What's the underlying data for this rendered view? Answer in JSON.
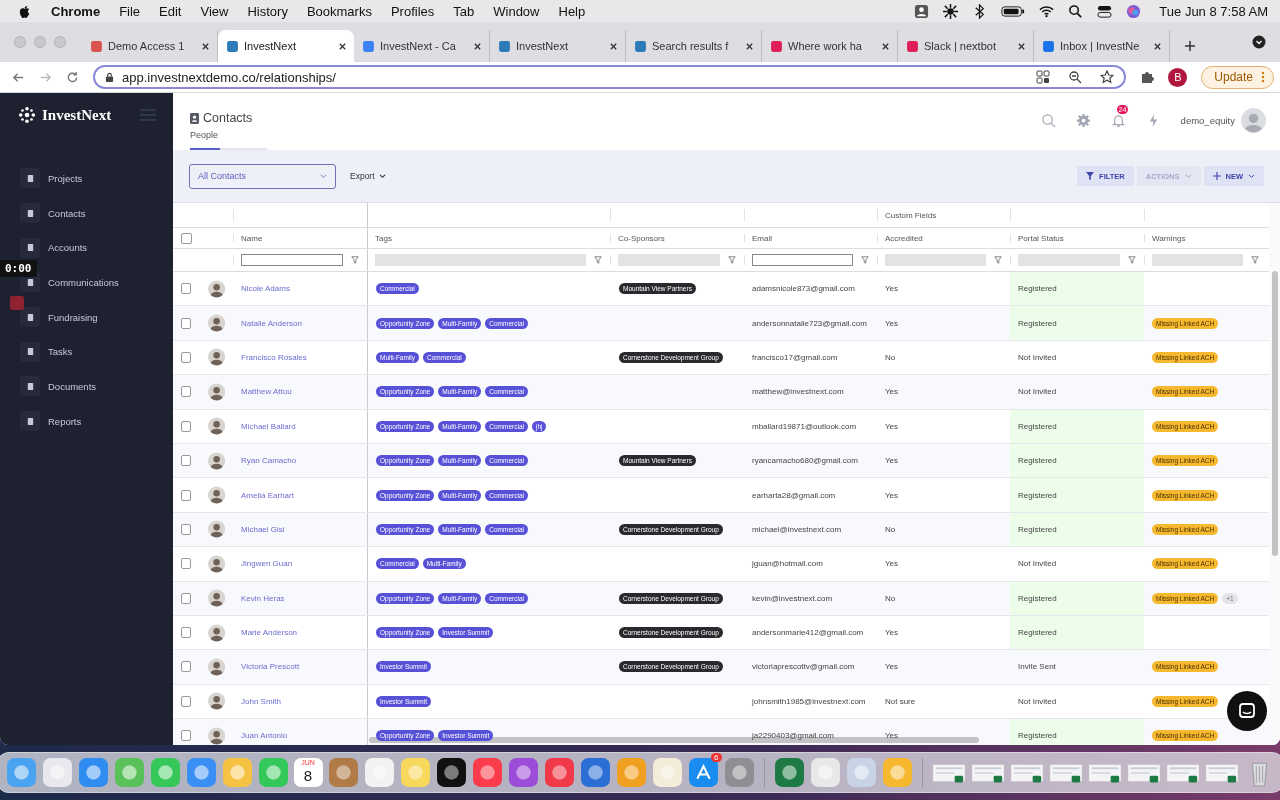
{
  "menubar": {
    "app": "Chrome",
    "menus": [
      "File",
      "Edit",
      "View",
      "History",
      "Bookmarks",
      "Profiles",
      "Tab",
      "Window",
      "Help"
    ],
    "clock": "Tue Jun 8  7:58 AM"
  },
  "browser": {
    "tabs": [
      {
        "title": "Demo Access 1",
        "selected": false
      },
      {
        "title": "InvestNext",
        "selected": true
      },
      {
        "title": "InvestNext - Ca",
        "selected": false
      },
      {
        "title": "InvestNext",
        "selected": false
      },
      {
        "title": "Search results f",
        "selected": false
      },
      {
        "title": "Where work ha",
        "selected": false
      },
      {
        "title": "Slack | nextbot",
        "selected": false
      },
      {
        "title": "Inbox | InvestNe",
        "selected": false
      }
    ],
    "url": "app.investnextdemo.co/relationships/",
    "profile": "B",
    "update": "Update"
  },
  "sidebar": {
    "logo": "InvestNext",
    "items": [
      "Projects",
      "Contacts",
      "Accounts",
      "Communications",
      "Fundraising",
      "Tasks",
      "Documents",
      "Reports"
    ]
  },
  "video_overlay": {
    "time": "0:00"
  },
  "header": {
    "title": "Contacts",
    "tabs": [
      {
        "label": "People",
        "selected": true
      }
    ],
    "notifications": "24",
    "user": "demo_equity"
  },
  "toolbar": {
    "view": "All Contacts",
    "export": "Export",
    "filter": "FILTER",
    "actions": "ACTIONS",
    "new": "NEW"
  },
  "table": {
    "select_all_checked": false,
    "group_header": "Custom Fields",
    "columns": [
      {
        "label": "Name",
        "filter_disabled": false
      },
      {
        "label": "Tags",
        "filter_disabled": true
      },
      {
        "label": "Co-Sponsors",
        "filter_disabled": true
      },
      {
        "label": "Email",
        "filter_disabled": false
      },
      {
        "label": "Accredited",
        "filter_disabled": true
      },
      {
        "label": "Portal Status",
        "filter_disabled": true
      },
      {
        "label": "Warnings",
        "filter_disabled": true
      }
    ],
    "rows": [
      {
        "checked": false,
        "name": "Nicole Adams",
        "tags": [
          "Commercial"
        ],
        "sponsor": "Mountain View Partners",
        "email": "adamsnicole873@gmail.com",
        "accredited": "Yes",
        "status": "Registered",
        "status_highlight": true
      },
      {
        "checked": false,
        "name": "Natalie Anderson",
        "tags": [
          "Opportunity Zone",
          "Multi-Family",
          "Commercial"
        ],
        "email": "andersonnatalie723@gmail.com",
        "accredited": "Yes",
        "status": "Registered",
        "status_highlight": true,
        "warnings": [
          "Missing Linked ACH"
        ]
      },
      {
        "checked": false,
        "name": "Francisco Rosales",
        "tags": [
          "Multi-Family",
          "Commercial"
        ],
        "sponsor": "Cornerstone Development Group",
        "email": "francisco17@gmail.com",
        "accredited": "No",
        "status": "Not Invited",
        "status_highlight": false,
        "warnings": [
          "Missing Linked ACH"
        ]
      },
      {
        "checked": false,
        "name": "Matthew Attou",
        "tags": [
          "Opportunity Zone",
          "Multi-Family",
          "Commercial"
        ],
        "email": "matthew@investnext.com",
        "accredited": "Yes",
        "status": "Not Invited",
        "status_highlight": false,
        "warnings": [
          "Missing Linked ACH"
        ]
      },
      {
        "checked": false,
        "name": "Michael Ballard",
        "tags": [
          "Opportunity Zone",
          "Multi-Family",
          "Commercial",
          "jhj"
        ],
        "email": "mballard19871@outlook.com",
        "accredited": "Yes",
        "status": "Registered",
        "status_highlight": true,
        "warnings": [
          "Missing Linked ACH"
        ]
      },
      {
        "checked": false,
        "name": "Ryan Camacho",
        "tags": [
          "Opportunity Zone",
          "Multi-Family",
          "Commercial"
        ],
        "sponsor": "Mountain View Partners",
        "email": "ryancamacho680@gmail.com",
        "accredited": "Yes",
        "status": "Registered",
        "status_highlight": true,
        "warnings": [
          "Missing Linked ACH"
        ]
      },
      {
        "checked": false,
        "name": "Amelia Earhart",
        "tags": [
          "Opportunity Zone",
          "Multi-Family",
          "Commercial"
        ],
        "email": "earharta28@gmail.com",
        "accredited": "Yes",
        "status": "Registered",
        "status_highlight": true,
        "warnings": [
          "Missing Linked ACH"
        ]
      },
      {
        "checked": false,
        "name": "Michael Gisi",
        "tags": [
          "Opportunity Zone",
          "Multi-Family",
          "Commercial"
        ],
        "sponsor": "Cornerstone Development Group",
        "email": "michael@investnext.com",
        "accredited": "No",
        "status": "Registered",
        "status_highlight": true,
        "warnings": [
          "Missing Linked ACH"
        ]
      },
      {
        "checked": false,
        "name": "Jingwen Guan",
        "tags": [
          "Commercial",
          "Multi-Family"
        ],
        "email": "jguan@hotmail.com",
        "accredited": "Yes",
        "status": "Not Invited",
        "status_highlight": false,
        "warnings": [
          "Missing Linked ACH"
        ]
      },
      {
        "checked": false,
        "name": "Kevin Heras",
        "tags": [
          "Opportunity Zone",
          "Multi-Family",
          "Commercial"
        ],
        "sponsor": "Cornerstone Development Group",
        "email": "kevin@investnext.com",
        "accredited": "No",
        "status": "Registered",
        "status_highlight": true,
        "warnings": [
          "Missing Linked ACH"
        ],
        "more": "+1"
      },
      {
        "checked": false,
        "name": "Marie Anderson",
        "tags": [
          "Opportunity Zone",
          "Investor Summit"
        ],
        "sponsor": "Cornerstone Development Group",
        "email": "andersonmarie412@gmail.com",
        "accredited": "Yes",
        "status": "Registered",
        "status_highlight": true
      },
      {
        "checked": false,
        "name": "Victoria Prescott",
        "tags": [
          "Investor Summit"
        ],
        "sponsor": "Cornerstone Development Group",
        "email": "victoriaprescottv@gmail.com",
        "accredited": "Yes",
        "status": "Invite Sent",
        "status_highlight": false,
        "warnings": [
          "Missing Linked ACH"
        ]
      },
      {
        "checked": false,
        "name": "John Smith",
        "tags": [
          "Investor Summit"
        ],
        "email": "johnsmith1985@investnext.com",
        "accredited": "Not sure",
        "status": "Not Invited",
        "status_highlight": false,
        "warnings": [
          "Missing Linked ACH"
        ]
      },
      {
        "checked": false,
        "name": "Juan Antonio",
        "tags": [
          "Opportunity Zone",
          "Investor Summit"
        ],
        "email": "ja2290403@gmail.com",
        "accredited": "Yes",
        "status": "Registered",
        "status_highlight": true,
        "warnings": [
          "Missing Linked ACH"
        ]
      }
    ]
  },
  "dock": {
    "calendar_month": "JUN",
    "calendar_day": "8",
    "app_store_badge": "6"
  }
}
